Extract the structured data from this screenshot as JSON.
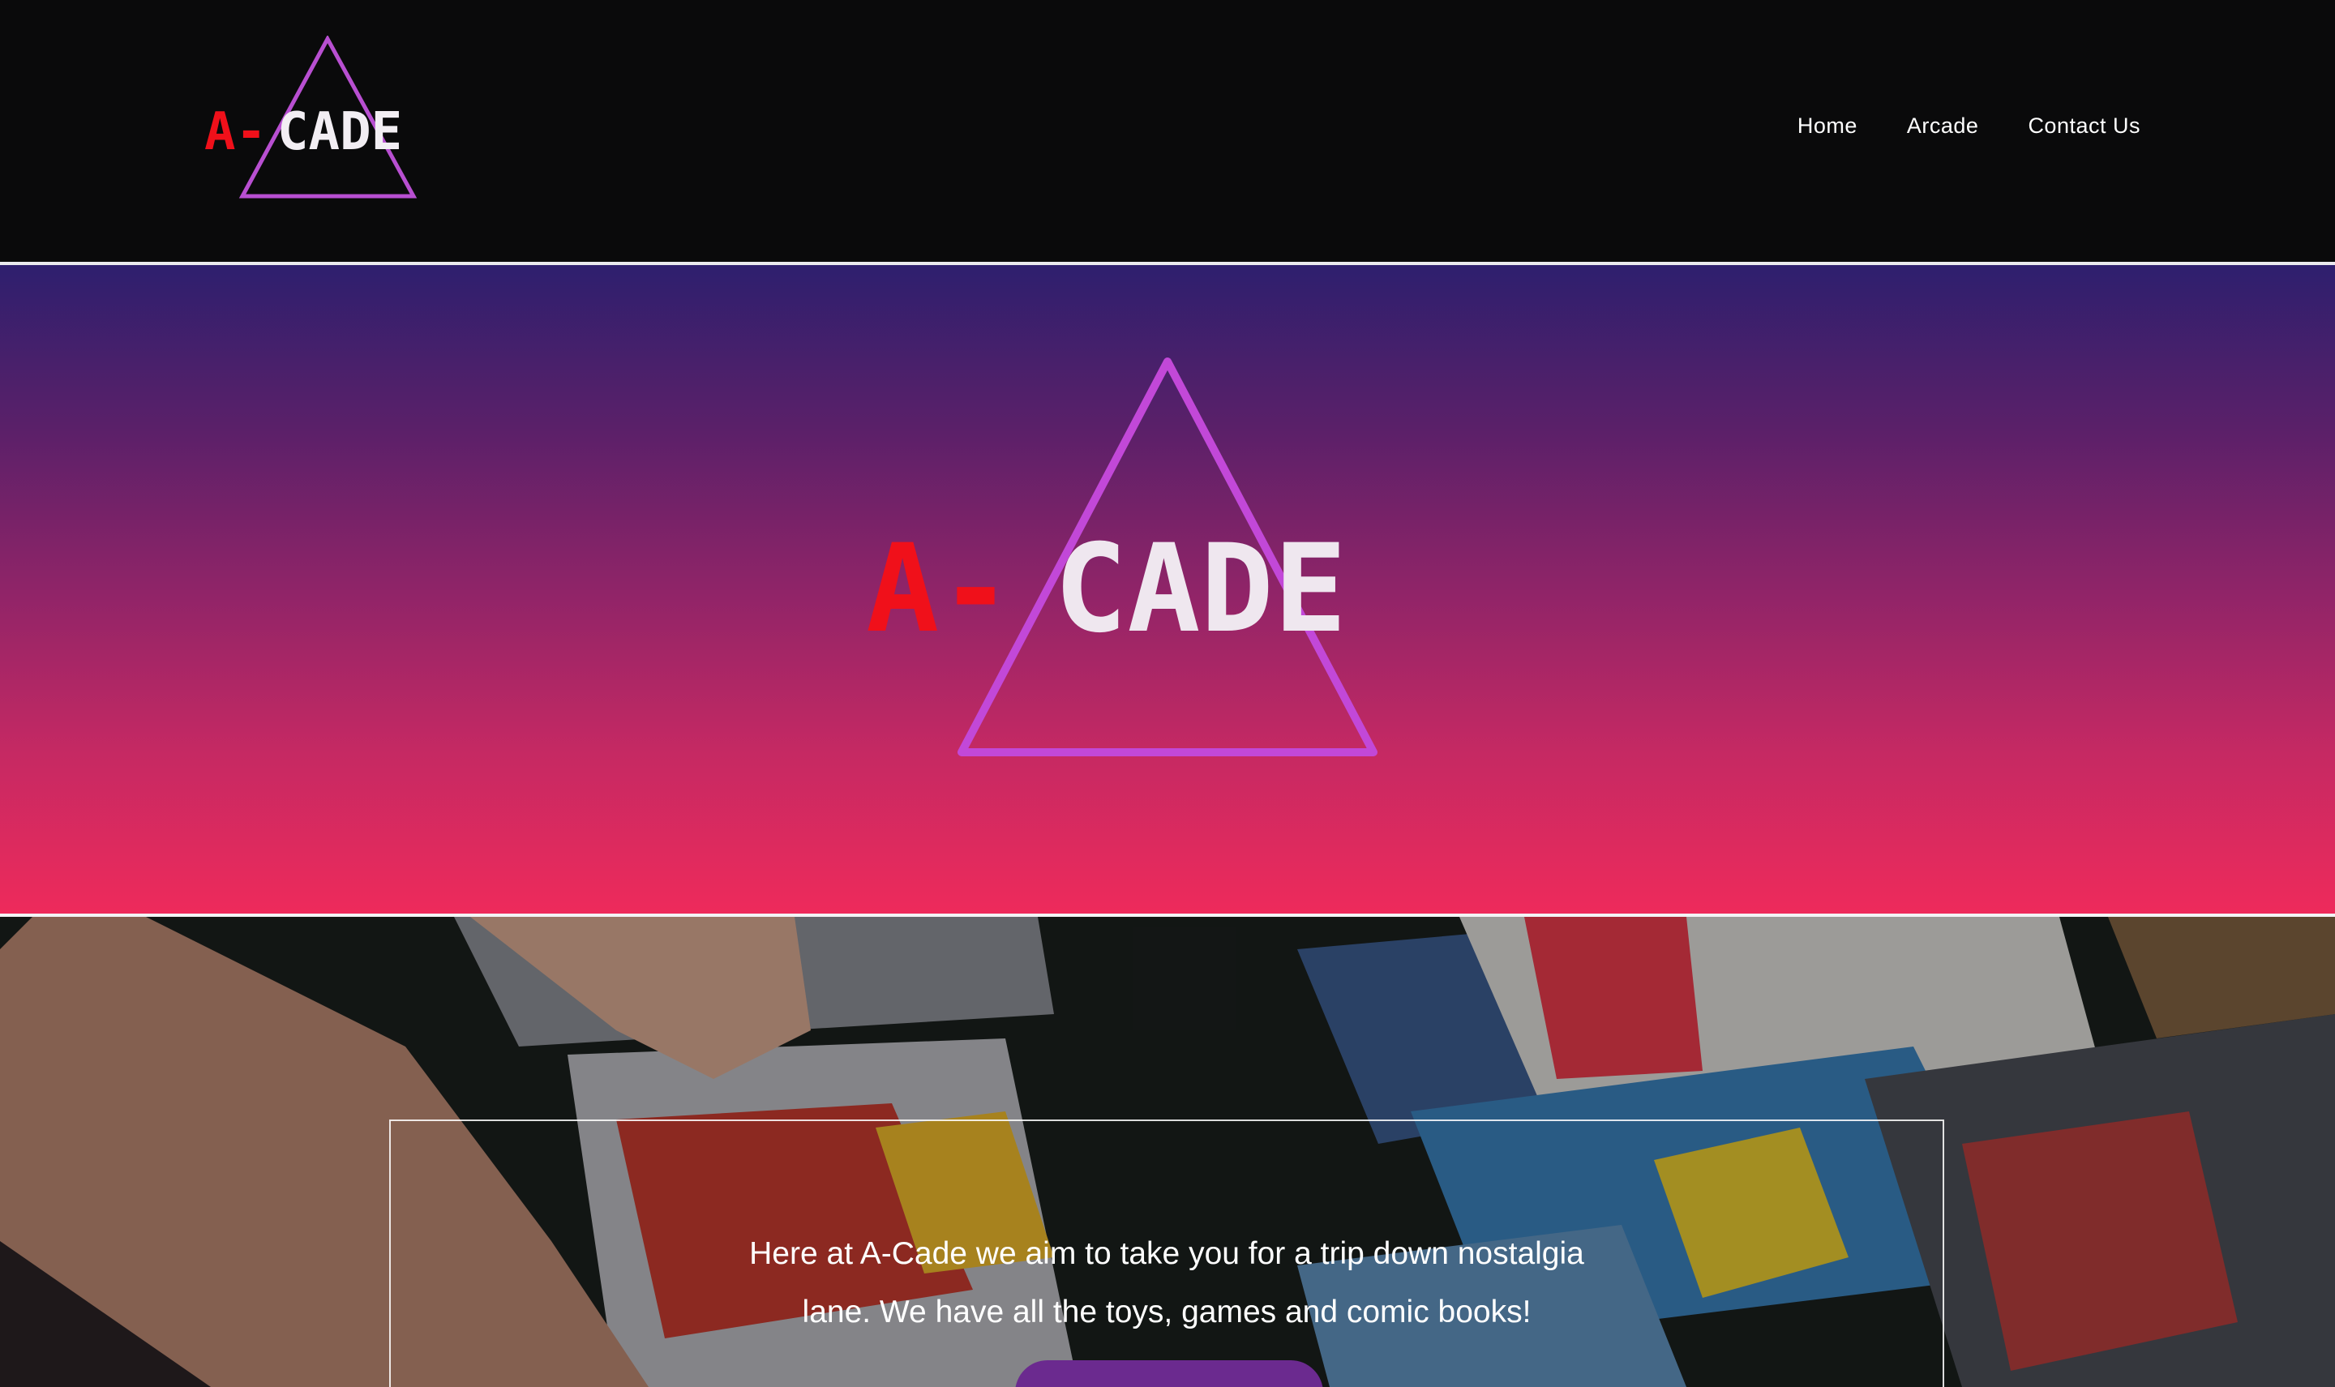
{
  "header": {
    "logo": {
      "letters_red": "A-",
      "letters_white": "CADE"
    },
    "nav": [
      {
        "label": "Home"
      },
      {
        "label": "Arcade"
      },
      {
        "label": "Contact Us"
      }
    ]
  },
  "hero": {
    "logo": {
      "letters_red": "A-",
      "letters_white": "CADE"
    },
    "gradient_colors": [
      "#2e1f6e",
      "#5a2069",
      "#8f2468",
      "#c52963",
      "#ee2a5b"
    ]
  },
  "intro": {
    "line1": "Here at A-Cade we aim to take you for a trip down nostalgia",
    "line2": "lane. We have all the toys, games and comic books!"
  },
  "colors": {
    "brand_red": "#f0101a",
    "triangle_purple": "#b84fd1",
    "button_purple": "#6b2a8f"
  }
}
